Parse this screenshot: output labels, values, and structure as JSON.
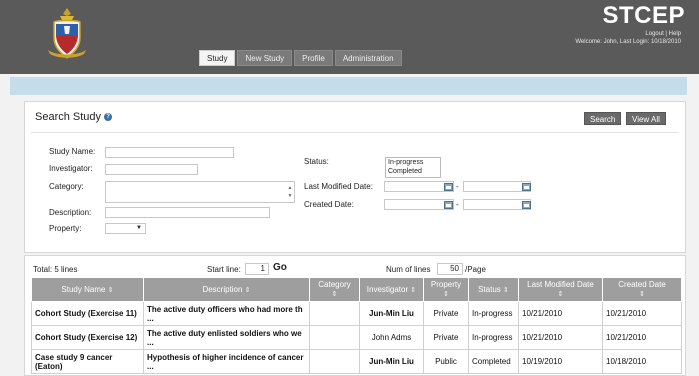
{
  "brand": "STCEP",
  "header": {
    "logout": "Logout",
    "sep": "|",
    "help": "Help",
    "welcome": "Welcome: John, Last Login: 10/18/2010"
  },
  "nav": [
    "Study",
    "New Study",
    "Profile",
    "Administration"
  ],
  "search": {
    "title": "Search Study",
    "search_btn": "Search",
    "viewall_btn": "View All",
    "labels": {
      "study_name": "Study Name:",
      "investigator": "Investigator:",
      "category": "Category:",
      "description": "Description:",
      "property": "Property:",
      "status": "Status:",
      "last_modified": "Last Modified Date:",
      "created": "Created Date:"
    },
    "status_options": [
      "In-progress",
      "Completed"
    ],
    "dash": "-"
  },
  "results": {
    "total": "Total:  5 lines",
    "start_line_label": "Start line:",
    "start_line_value": "1",
    "go": "Go",
    "num_lines_label": "Num of lines",
    "num_lines_value": "50",
    "per_page": "/Page",
    "columns": [
      "Study Name",
      "Description",
      "Category",
      "Investigator",
      "Property",
      "Status",
      "Last Modified Date",
      "Created Date"
    ],
    "rows": [
      [
        "Cohort Study (Exercise 11)",
        "The active duty officers who had more th ...",
        "",
        "Jun-Min Liu",
        "Private",
        "In-progress",
        "10/21/2010",
        "10/21/2010"
      ],
      [
        "Cohort Study (Exercise 12)",
        "The active duty enlisted soldiers who we ...",
        "",
        "John Adms",
        "Private",
        "In-progress",
        "10/21/2010",
        "10/21/2010"
      ],
      [
        "Case study 9 cancer (Eaton)",
        "Hypothesis of higher incidence of cancer ...",
        "",
        "Jun-Min Liu",
        "Public",
        "Completed",
        "10/19/2010",
        "10/18/2010"
      ]
    ]
  },
  "colors": {
    "header_bg": "#5a5a5a",
    "accent_bar": "#c5dceb",
    "table_header": "#9e9e9e",
    "button_bg": "#6a6a6a"
  }
}
